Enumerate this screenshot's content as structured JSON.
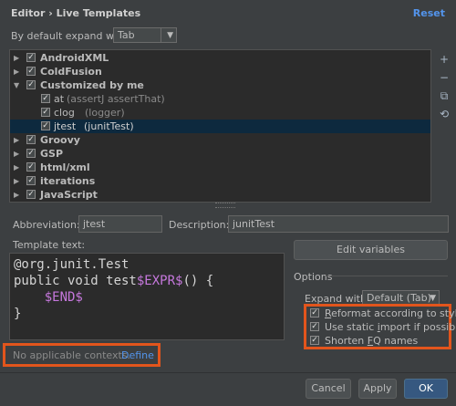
{
  "header": {
    "breadcrumb": "Editor › Live Templates",
    "reset_label": "Reset"
  },
  "expand": {
    "label": "By default expand with",
    "value": "Tab"
  },
  "tree": {
    "groups": [
      {
        "label": "AndroidXML"
      },
      {
        "label": "ColdFusion"
      },
      {
        "label": "Customized by me"
      },
      {
        "label": "Groovy"
      },
      {
        "label": "GSP"
      },
      {
        "label": "html/xml"
      },
      {
        "label": "iterations"
      },
      {
        "label": "JavaScript"
      }
    ],
    "children": [
      {
        "label": "at",
        "hint": "(assertJ assertThat)"
      },
      {
        "label": "clog",
        "hint": "(logger)"
      },
      {
        "label": "jtest",
        "hint": "(junitTest)"
      }
    ]
  },
  "form": {
    "abbreviation_label": "Abbreviation:",
    "abbreviation_value": "jtest",
    "description_label": "Description:",
    "description_value": "junitTest",
    "template_text_label": "Template text:"
  },
  "code": {
    "line1": "@org.junit.Test",
    "line2_prefix": "public void test",
    "line2_var": "$EXPR$",
    "line2_suffix": "() {",
    "line3_var": "$END$",
    "line4": "}"
  },
  "options": {
    "edit_variables_label": "Edit variables",
    "section_label": "Options",
    "expand_with_label": "Expand with",
    "expand_with_value": "Default (Tab)",
    "reformat_pre": "",
    "reformat_u": "R",
    "reformat_post": "eformat according to style",
    "static_pre": "Use static ",
    "static_u": "i",
    "static_post": "mport if possible",
    "shorten_pre": "Shorten ",
    "shorten_u": "F",
    "shorten_post": "Q names"
  },
  "contexts": {
    "message": "No applicable contexts.",
    "define_label": "Define"
  },
  "footer": {
    "cancel_label": "Cancel",
    "apply_label": "Apply",
    "ok_label": "OK"
  },
  "colors": {
    "background": "#3c3f41",
    "selection": "#0d293e",
    "link": "#5394ec",
    "highlight": "#e2551c",
    "template_var": "#c678dd"
  }
}
